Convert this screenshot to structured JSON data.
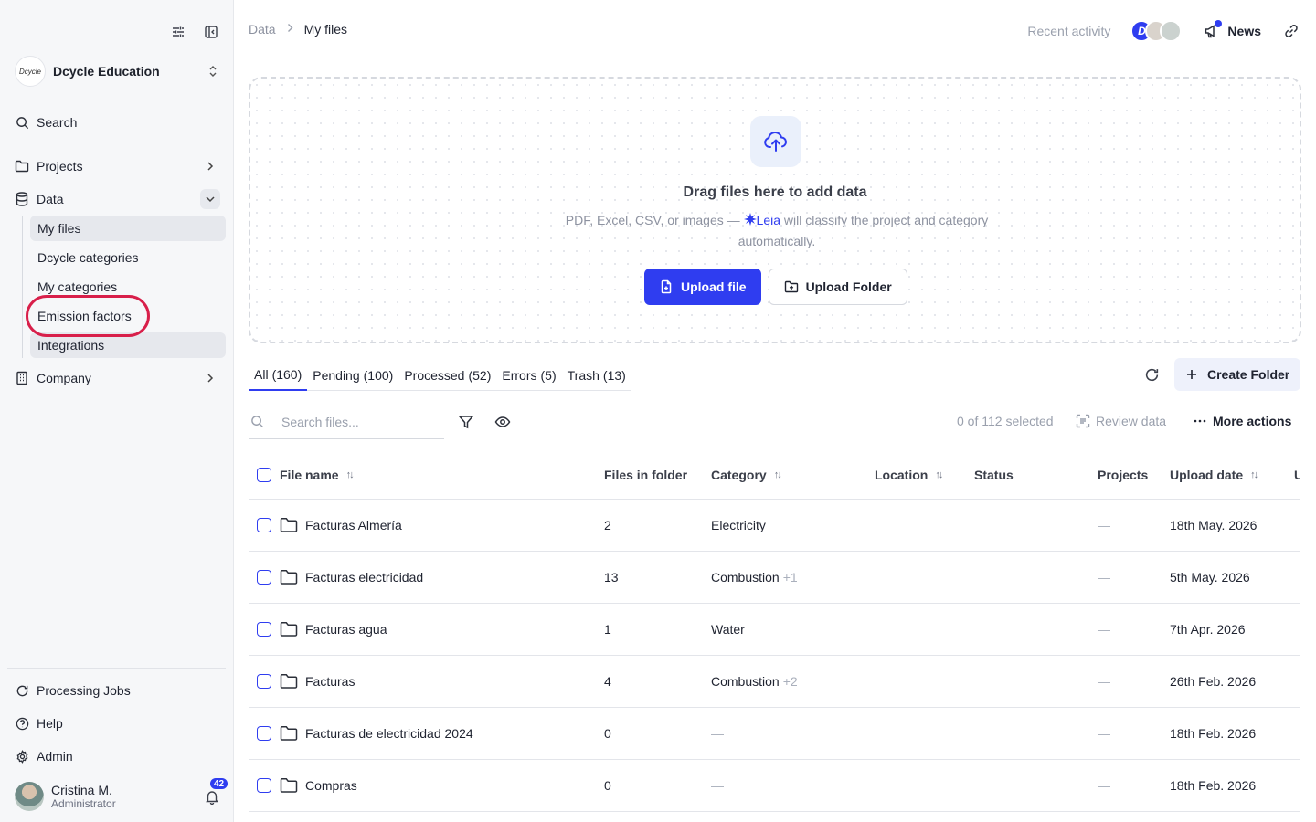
{
  "sidebar": {
    "org_logo": "Dcycle",
    "org_name": "Dcycle Education",
    "search_label": "Search",
    "projects_label": "Projects",
    "data_label": "Data",
    "sub_items": [
      "My files",
      "Dcycle categories",
      "My categories",
      "Emission factors",
      "Integrations"
    ],
    "company_label": "Company",
    "processing_label": "Processing Jobs",
    "help_label": "Help",
    "admin_label": "Admin",
    "user_name": "Cristina M.",
    "user_role": "Administrator",
    "notifications": "42"
  },
  "header": {
    "crumb_root": "Data",
    "crumb_current": "My files",
    "recent_activity": "Recent activity",
    "news_label": "News"
  },
  "dropzone": {
    "title": "Drag files here to add data",
    "sub_prefix": "PDF, Excel, CSV, or images —",
    "leia": "Leia",
    "sub_suffix": "will classify the project and category automatically.",
    "upload_file": "Upload file",
    "upload_folder": "Upload Folder"
  },
  "tabs": [
    {
      "label": "All",
      "count": "(160)"
    },
    {
      "label": "Pending",
      "count": "(100)"
    },
    {
      "label": "Processed",
      "count": "(52)"
    },
    {
      "label": "Errors",
      "count": "(5)"
    },
    {
      "label": "Trash",
      "count": "(13)"
    }
  ],
  "actions": {
    "create_folder": "Create Folder",
    "search_placeholder": "Search files...",
    "selected": "0 of 112 selected",
    "review": "Review data",
    "more": "More actions"
  },
  "table": {
    "headers": {
      "name": "File name",
      "files": "Files in folder",
      "category": "Category",
      "location": "Location",
      "status": "Status",
      "projects": "Projects",
      "date": "Upload date",
      "extra": "U"
    },
    "rows": [
      {
        "name": "Facturas Almería",
        "files": "2",
        "category": "Electricity",
        "extra": "",
        "projects": "—",
        "date": "18th May. 2026"
      },
      {
        "name": "Facturas electricidad",
        "files": "13",
        "category": "Combustion",
        "extra": "+1",
        "projects": "—",
        "date": "5th May. 2026"
      },
      {
        "name": "Facturas agua",
        "files": "1",
        "category": "Water",
        "extra": "",
        "projects": "—",
        "date": "7th Apr. 2026"
      },
      {
        "name": "Facturas",
        "files": "4",
        "category": "Combustion",
        "extra": "+2",
        "projects": "—",
        "date": "26th Feb. 2026"
      },
      {
        "name": "Facturas de electricidad 2024",
        "files": "0",
        "category": "—",
        "extra": "",
        "projects": "—",
        "date": "18th Feb. 2026"
      },
      {
        "name": "Compras",
        "files": "0",
        "category": "—",
        "extra": "",
        "projects": "—",
        "date": "18th Feb. 2026"
      }
    ]
  },
  "colors": {
    "accent": "#2f3df0",
    "highlight_circle": "#d81f4a"
  }
}
